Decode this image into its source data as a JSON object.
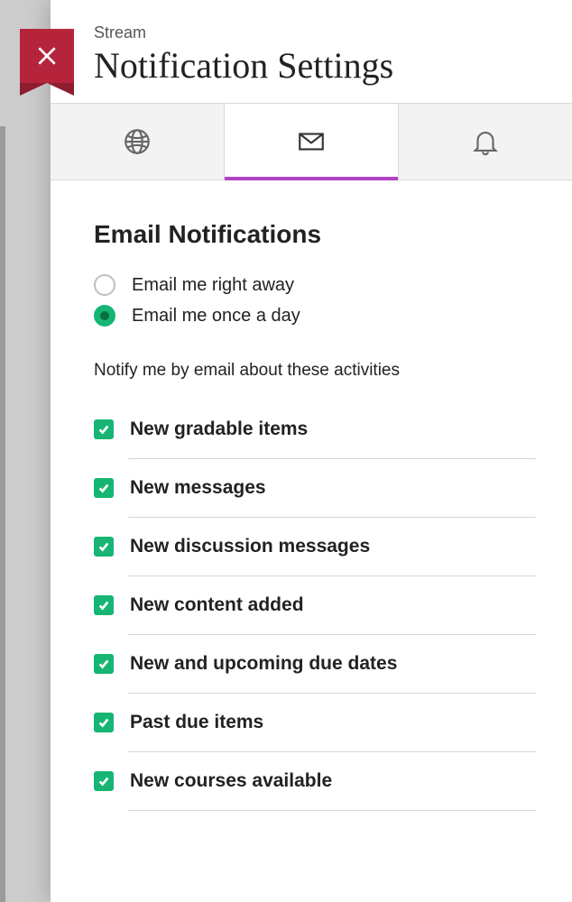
{
  "breadcrumb": "Stream",
  "title": "Notification Settings",
  "tabs": {
    "global": {
      "active": false
    },
    "email": {
      "active": true
    },
    "push": {
      "active": false
    }
  },
  "section": {
    "heading": "Email Notifications",
    "frequency": {
      "options": [
        {
          "label": "Email me right away",
          "selected": false
        },
        {
          "label": "Email me once a day",
          "selected": true
        }
      ]
    },
    "activities_heading": "Notify me by email about these activities",
    "activities": [
      {
        "label": "New gradable items",
        "checked": true
      },
      {
        "label": "New messages",
        "checked": true
      },
      {
        "label": "New discussion messages",
        "checked": true
      },
      {
        "label": "New content added",
        "checked": true
      },
      {
        "label": "New and upcoming due dates",
        "checked": true
      },
      {
        "label": "Past due items",
        "checked": true
      },
      {
        "label": "New courses available",
        "checked": true
      }
    ]
  }
}
